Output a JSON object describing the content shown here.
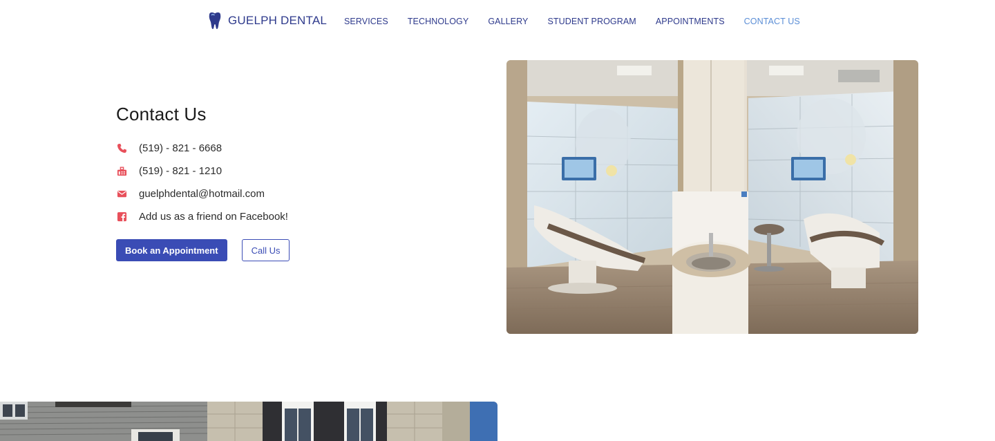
{
  "brand": {
    "name": "GUELPH DENTAL",
    "logo_icon": "tooth-logo-icon"
  },
  "nav": {
    "links": [
      {
        "label": "SERVICES",
        "active": false
      },
      {
        "label": "TECHNOLOGY",
        "active": false
      },
      {
        "label": "GALLERY",
        "active": false
      },
      {
        "label": "STUDENT PROGRAM",
        "active": false
      },
      {
        "label": "APPOINTMENTS",
        "active": false
      },
      {
        "label": "CONTACT US",
        "active": true
      }
    ]
  },
  "contact": {
    "title": "Contact Us",
    "phone": {
      "icon": "phone-icon",
      "text": "(519) - 821 - 6668"
    },
    "fax": {
      "icon": "fax-icon",
      "text": "(519) - 821 - 1210"
    },
    "email": {
      "icon": "email-icon",
      "text": "guelphdental@hotmail.com"
    },
    "facebook": {
      "icon": "facebook-icon",
      "text": "Add us as a friend on Facebook!"
    },
    "book_button": "Book an Appointment",
    "call_button": "Call Us"
  },
  "colors": {
    "brand": "#2e3a8c",
    "accent": "#3a4cb5",
    "nav_active": "#5b8ed6",
    "icon": "#e8505b"
  }
}
